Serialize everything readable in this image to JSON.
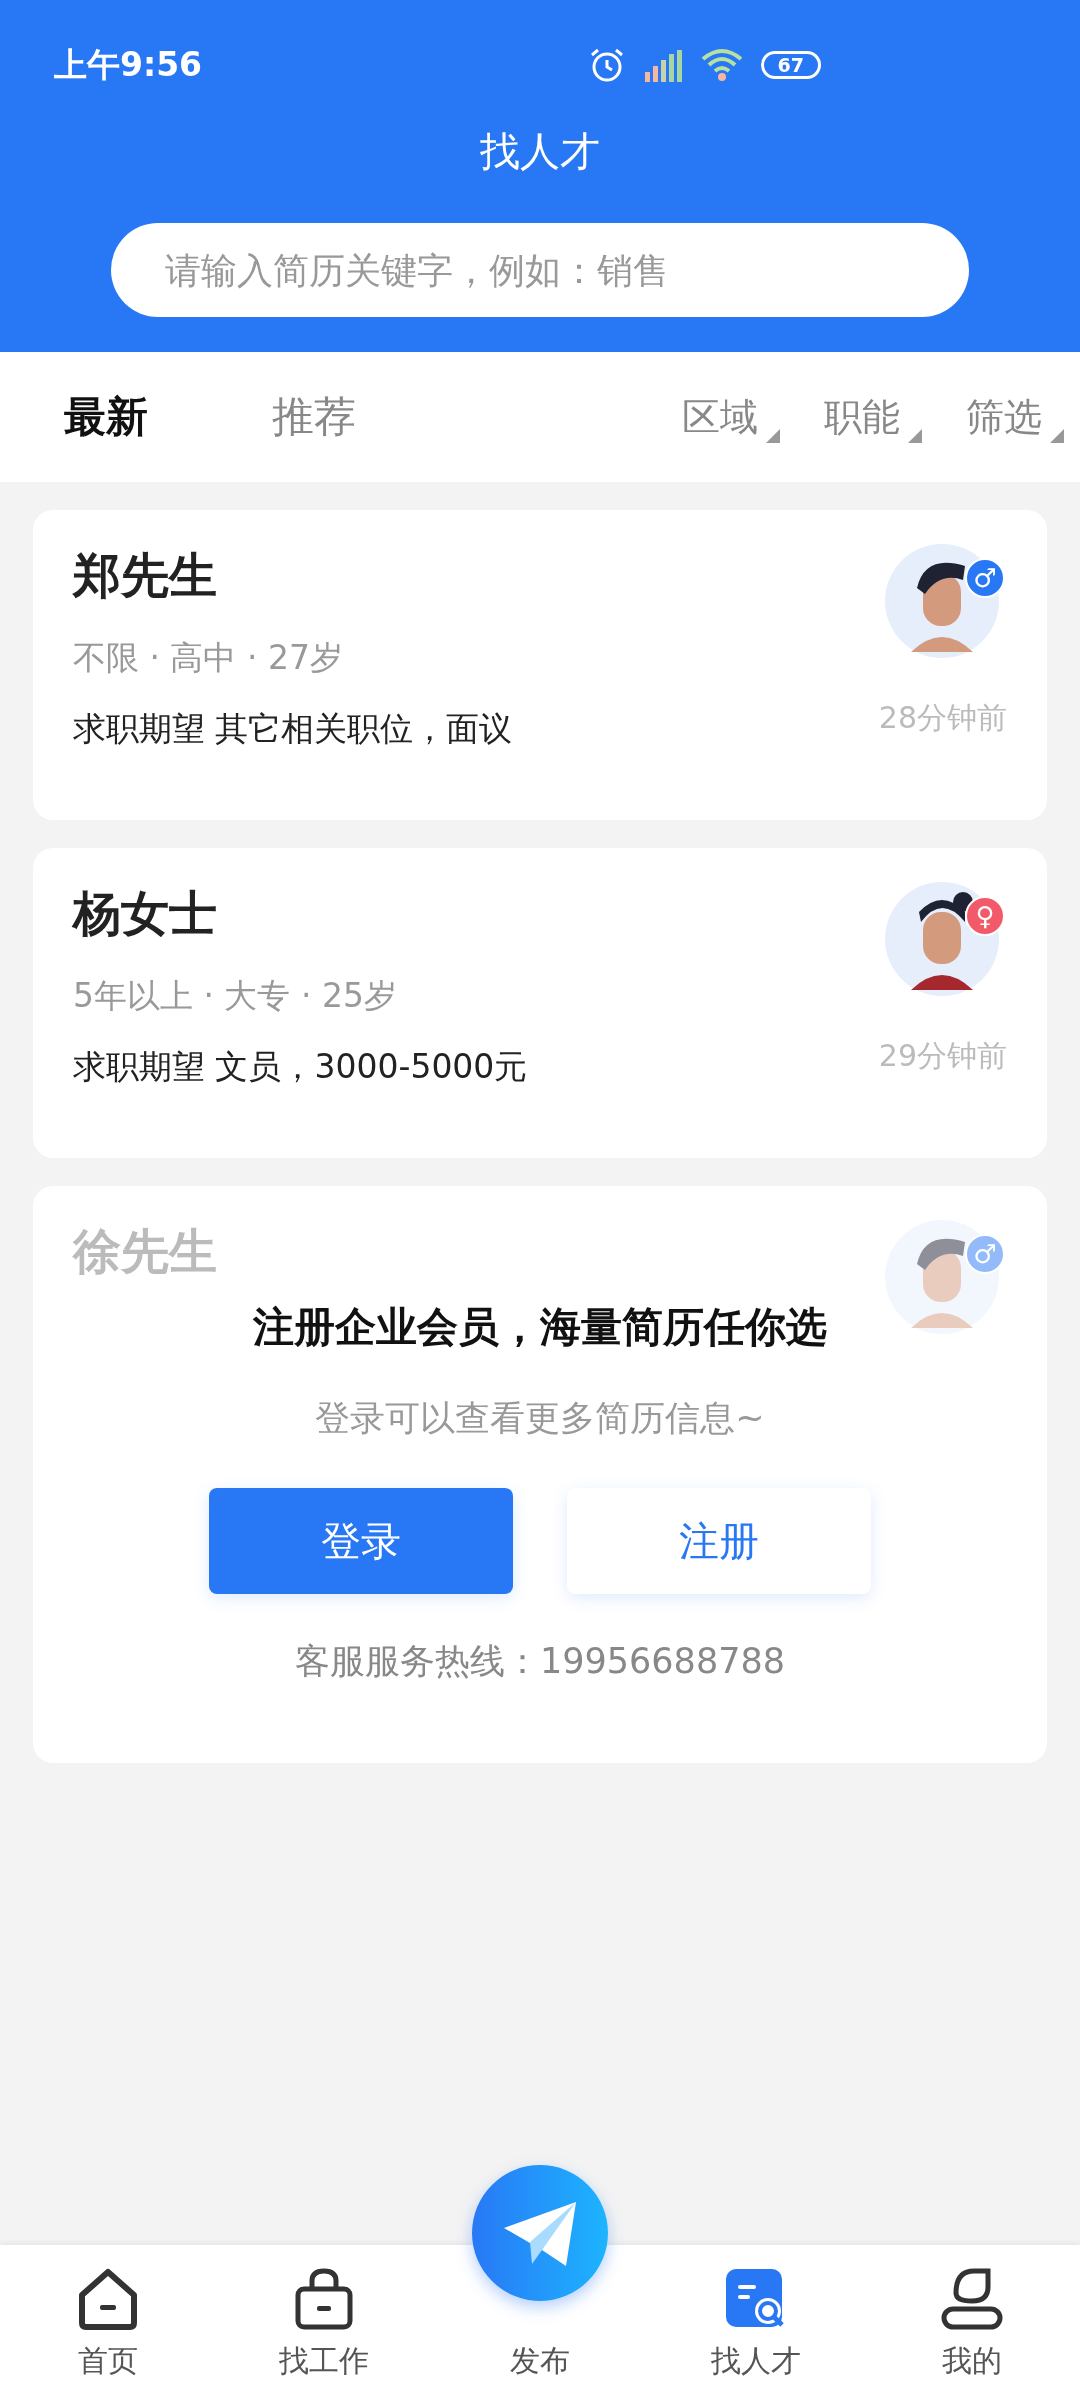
{
  "status_bar": {
    "time": "上午9:56",
    "battery": "67"
  },
  "header": {
    "title": "找人才"
  },
  "search": {
    "placeholder": "请输入简历关键字，例如：销售"
  },
  "tabs": [
    {
      "label": "最新",
      "selected": true
    },
    {
      "label": "推荐",
      "selected": false
    }
  ],
  "filters": [
    "区域",
    "职能",
    "筛选"
  ],
  "candidates": [
    {
      "name": "郑先生",
      "gender": "♂",
      "color": "#2878f5",
      "locked": false,
      "meta": "不限 · 高中 · 27岁",
      "expectation": "求职期望 其它相关职位，面议",
      "time": "28分钟前"
    },
    {
      "name": "杨女士",
      "gender": "♀",
      "color": "#f25a6a",
      "locked": false,
      "meta": "5年以上 · 大专 · 25岁",
      "expectation": "求职期望 文员，3000-5000元",
      "time": "29分钟前"
    },
    {
      "name": "徐先生",
      "gender": "♂",
      "color": "#93bbfa",
      "locked": true
    }
  ],
  "login_prompt": {
    "title": "注册企业会员，海量简历任你选",
    "subtitle": "登录可以查看更多简历信息~",
    "login_button": "登录",
    "register_button": "注册",
    "hotline": "客服服务热线：19956688788"
  },
  "bottom_nav": [
    {
      "label": "首页",
      "kind": "home",
      "selected": false
    },
    {
      "label": "找工作",
      "kind": "bag",
      "selected": false
    },
    {
      "label": "发布",
      "kind": "publish",
      "selected": false
    },
    {
      "label": "找人才",
      "kind": "talent",
      "selected": true
    },
    {
      "label": "我的",
      "kind": "profile",
      "selected": false
    }
  ]
}
